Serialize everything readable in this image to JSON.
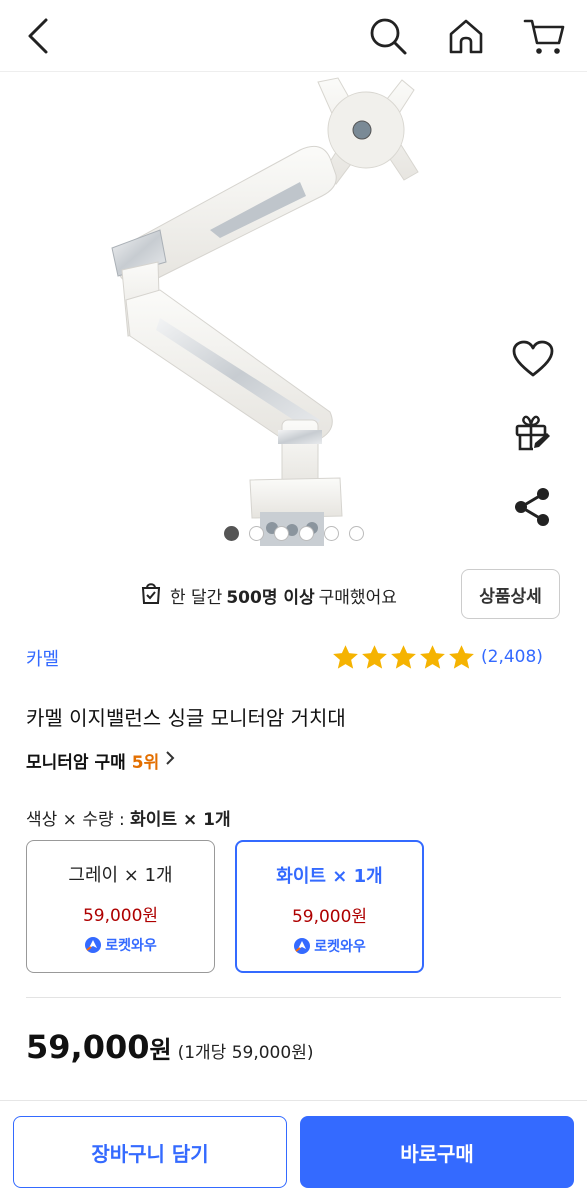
{
  "header": {
    "icons": [
      "back-arrow-icon",
      "search-icon",
      "home-icon",
      "cart-icon"
    ]
  },
  "gallery": {
    "image": "monitor-arm-product-photo",
    "dot_count": 6,
    "active_index": 0
  },
  "side_icons": [
    "heart-icon",
    "gift-icon",
    "share-icon"
  ],
  "buyers": {
    "prefix": "한 달간",
    "highlight": "500명 이상",
    "suffix": "구매했어요"
  },
  "detail_button_label": "상품상세",
  "product": {
    "brand": "카멜",
    "rating": 5,
    "review_count": "(2,408)",
    "title": "카멜 이지밸런스 싱글 모니터암 거치대",
    "rank_label": "모니터암 구매",
    "rank_value": "5위"
  },
  "option": {
    "label_prefix": "색상 × 수량 :",
    "label_selected": "화이트 × 1개",
    "items": [
      {
        "name": "그레이 × 1개",
        "price": "59,000원",
        "badge": "로켓와우",
        "selected": false
      },
      {
        "name": "화이트 × 1개",
        "price": "59,000원",
        "badge": "로켓와우",
        "selected": true
      }
    ]
  },
  "total": {
    "amount": "59,000",
    "currency": "원",
    "per_unit": "(1개당 59,000원)"
  },
  "actions": {
    "cart_label": "장바구니 담기",
    "buy_label": "바로구매"
  },
  "colors": {
    "accent": "#346aff",
    "price": "#ae0000",
    "rank": "#e36f00",
    "star": "#f5b301"
  }
}
